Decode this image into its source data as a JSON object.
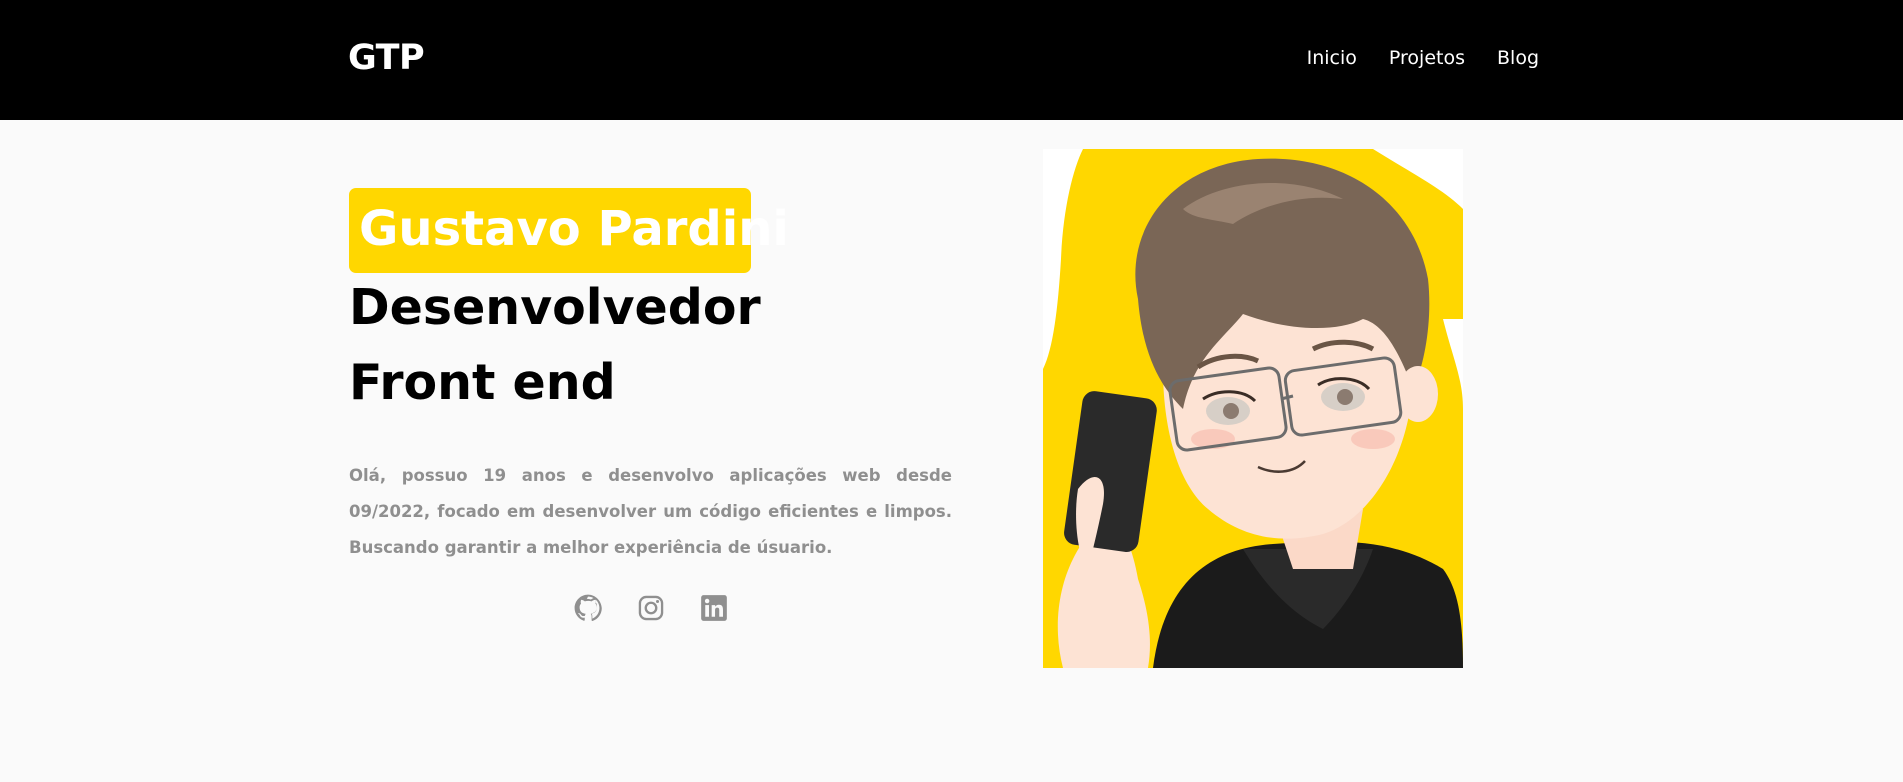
{
  "header": {
    "logo": "GTP",
    "nav": [
      "Inicio",
      "Projetos",
      "Blog"
    ]
  },
  "hero": {
    "name": "Gustavo Pardini",
    "role_line1": "Desenvolvedor",
    "role_line2": "Front end",
    "description": "Olá, possuo 19 anos e desenvolvo aplicações web desde 09/2022, focado em desenvolver um código eficientes e limpos. Buscando garantir a melhor experiência de úsuario."
  },
  "socials": [
    {
      "icon": "github-icon"
    },
    {
      "icon": "instagram-icon"
    },
    {
      "icon": "linkedin-icon"
    }
  ],
  "colors": {
    "header_bg": "#000000",
    "accent": "#ffd700",
    "background": "#fafafa",
    "text_muted": "#8f8f8f"
  }
}
